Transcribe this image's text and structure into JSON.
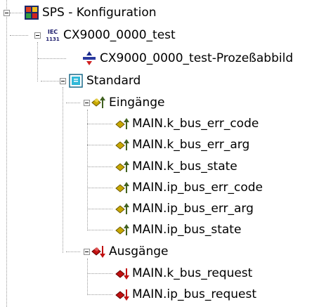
{
  "tree": {
    "root": {
      "label": "SPS - Konfiguration",
      "icon": "sps-config-icon"
    },
    "project": {
      "label": "CX9000_0000_test",
      "icon": "iec-1131-icon",
      "icon_text": [
        "IEC",
        "1131"
      ]
    },
    "process_image": {
      "label": "CX9000_0000_test-Prozeßabbild",
      "icon": "process-image-icon"
    },
    "task": {
      "label": "Standard",
      "icon": "task-icon"
    },
    "inputs": {
      "label": "Eingänge",
      "icon": "inputs-icon",
      "items": [
        {
          "label": "MAIN.k_bus_err_code"
        },
        {
          "label": "MAIN.k_bus_err_arg"
        },
        {
          "label": "MAIN.k_bus_state"
        },
        {
          "label": "MAIN.ip_bus_err_code"
        },
        {
          "label": "MAIN.ip_bus_err_arg"
        },
        {
          "label": "MAIN.ip_bus_state"
        }
      ]
    },
    "outputs": {
      "label": "Ausgänge",
      "icon": "outputs-icon",
      "items": [
        {
          "label": "MAIN.k_bus_request"
        },
        {
          "label": "MAIN.ip_bus_request"
        }
      ]
    }
  },
  "colors": {
    "tree_line": "#9a9a9a",
    "input_var": "#c8a800",
    "output_var": "#cc0000",
    "selection": "none"
  }
}
